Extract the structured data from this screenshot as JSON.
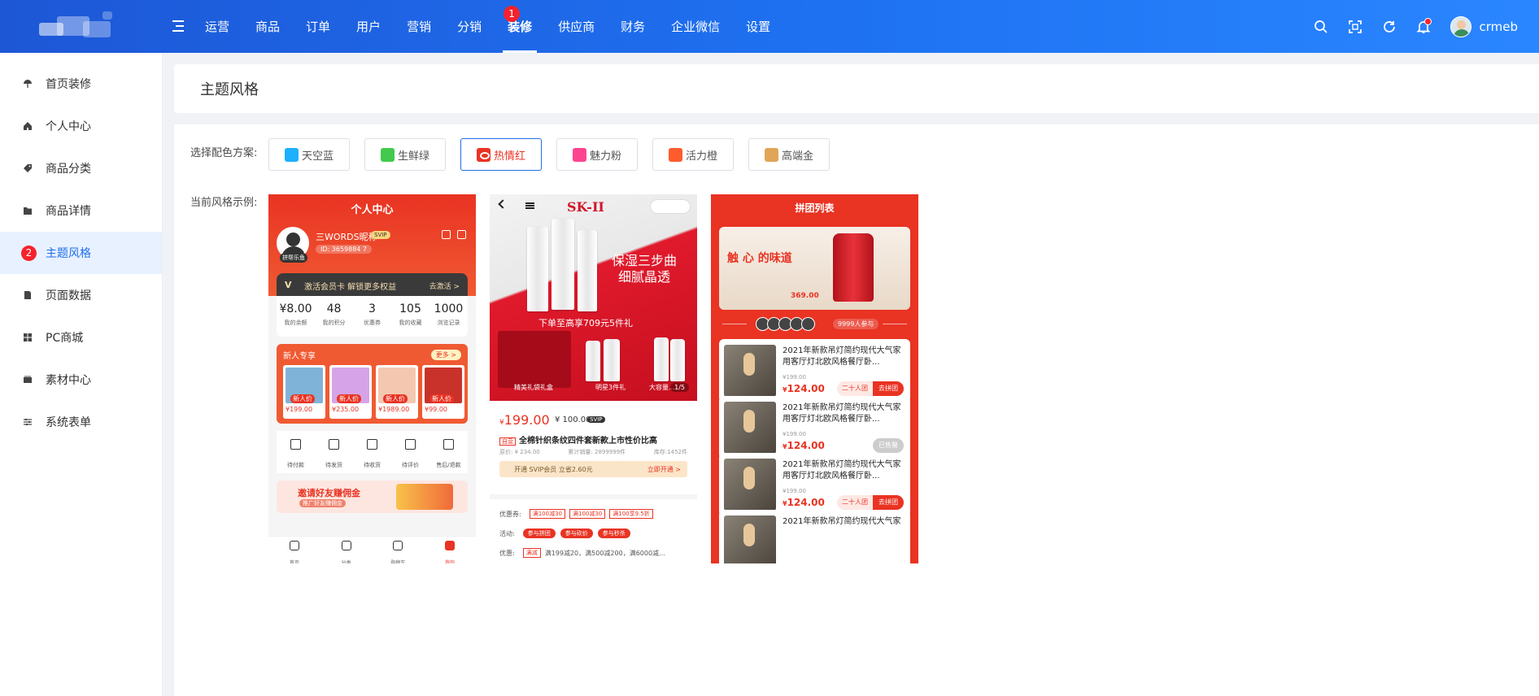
{
  "header": {
    "username": "crmeb",
    "nav": [
      {
        "label": "运营"
      },
      {
        "label": "商品"
      },
      {
        "label": "订单"
      },
      {
        "label": "用户"
      },
      {
        "label": "营销"
      },
      {
        "label": "分销"
      },
      {
        "label": "装修",
        "active": true,
        "badge": "1"
      },
      {
        "label": "供应商"
      },
      {
        "label": "财务"
      },
      {
        "label": "企业微信"
      },
      {
        "label": "设置"
      }
    ],
    "tools": [
      "search-icon",
      "fullscreen-icon",
      "refresh-icon",
      "bell-icon"
    ]
  },
  "sidebar": {
    "items": [
      {
        "label": "首页装修",
        "icon": "umbrella-icon"
      },
      {
        "label": "个人中心",
        "icon": "home-icon"
      },
      {
        "label": "商品分类",
        "icon": "tag-icon"
      },
      {
        "label": "商品详情",
        "icon": "folder-icon"
      },
      {
        "label": "主题风格",
        "icon": "palette-icon",
        "active": true,
        "badge": "2"
      },
      {
        "label": "页面数据",
        "icon": "file-icon"
      },
      {
        "label": "PC商城",
        "icon": "windows-icon"
      },
      {
        "label": "素材中心",
        "icon": "media-icon"
      },
      {
        "label": "系统表单",
        "icon": "sliders-icon"
      }
    ]
  },
  "page": {
    "title": "主题风格",
    "scheme_label": "选择配色方案:",
    "preview_label": "当前风格示例:"
  },
  "schemes": [
    {
      "label": "天空蓝",
      "color": "#1db0fc"
    },
    {
      "label": "生鲜绿",
      "color": "#42ca4d"
    },
    {
      "label": "热情红",
      "color": "#e93323",
      "selected": true
    },
    {
      "label": "魅力粉",
      "color": "#ff448f"
    },
    {
      "label": "活力橙",
      "color": "#fe5c2d"
    },
    {
      "label": "高端金",
      "color": "#e0a558"
    }
  ],
  "preview1": {
    "title": "个人中心",
    "avatar_tag": "拼帮乐鱼",
    "name": "三WORDS昵称",
    "svip": "SVIP",
    "id": "ID: 3659884 7",
    "vip_mark": "V",
    "vip_text": "激活会员卡 解锁更多权益",
    "vip_link": "去激活 >",
    "stats": [
      {
        "value": "¥8.00",
        "label": "我的余额"
      },
      {
        "value": "48",
        "label": "我的积分"
      },
      {
        "value": "3",
        "label": "优惠券"
      },
      {
        "value": "105",
        "label": "我的收藏"
      },
      {
        "value": "1000",
        "label": "浏览记录"
      }
    ],
    "new_title": "新人专享",
    "new_more": "更多 >",
    "products": [
      {
        "tag": "新人价",
        "price": "¥199.00",
        "color": "#7fb3d8"
      },
      {
        "tag": "新人价",
        "price": "¥235.00",
        "color": "#d7a3e8"
      },
      {
        "tag": "新人价",
        "price": "¥1989.00",
        "color": "#f4c7b0"
      },
      {
        "tag": "新人价",
        "price": "¥99.00",
        "color": "#c8322a"
      }
    ],
    "orders": [
      "待付款",
      "待发货",
      "待收货",
      "待评价",
      "售后/退款"
    ],
    "invite_title": "邀请好友赚佣金",
    "invite_sub": "推广好友赚佣金",
    "tabs": [
      {
        "label": "首页"
      },
      {
        "label": "分类"
      },
      {
        "label": "购物车"
      },
      {
        "label": "我的",
        "active": true
      }
    ]
  },
  "preview2": {
    "brand": "SK-II",
    "slogan1": "保湿三步曲",
    "slogan2": "细腻晶透",
    "strip": "下单至高享709元5件礼",
    "cap1": "精美礼袋礼盒",
    "cap2": "明星3件礼",
    "cap3": "大容量...",
    "page": "1/5",
    "price": "199.00",
    "price_symbol": "¥",
    "price2": "¥ 100.00",
    "svip": "SVIP",
    "tag": "自营",
    "name": "全棉针织条纹四件套新款上市性价比高",
    "orig": "原价: ¥ 234.00",
    "sold": "累计销量: 2899999件",
    "stock": "库存:1452件",
    "open_text": "开通 SVIP会员 立省2.60元",
    "open_link": "立即开通 >",
    "coupon_label": "优惠券:",
    "coupons": [
      "满100减30",
      "满100减30",
      "满100享9.5折"
    ],
    "activity_label": "活动:",
    "activities": [
      "参与拼团",
      "参与砍价",
      "参与秒杀"
    ],
    "promo_label": "优惠:",
    "promo_tag": "满减",
    "promo_text": "满199减20，满500减200，满6000减..."
  },
  "preview3": {
    "title": "拼团列表",
    "slogan": "触 心 的味道",
    "banner_price": "369.00",
    "people": "9999人参与",
    "items": [
      {
        "name": "2021年新款吊灯简约现代大气家用客厅灯北欧风格餐厅卧...",
        "old": "¥199.00",
        "price": "124.00",
        "group": "二十人团",
        "action": "去拼团",
        "done": false
      },
      {
        "name": "2021年新款吊灯简约现代大气家用客厅灯北欧风格餐厅卧...",
        "old": "¥199.00",
        "price": "124.00",
        "group": "",
        "action": "已售罄",
        "done": true
      },
      {
        "name": "2021年新款吊灯简约现代大气家用客厅灯北欧风格餐厅卧...",
        "old": "¥199.00",
        "price": "124.00",
        "group": "二十人团",
        "action": "去拼团",
        "done": false
      },
      {
        "name": "2021年新款吊灯简约现代大气家",
        "old": "",
        "price": "",
        "group": "",
        "action": "",
        "done": false
      }
    ]
  }
}
